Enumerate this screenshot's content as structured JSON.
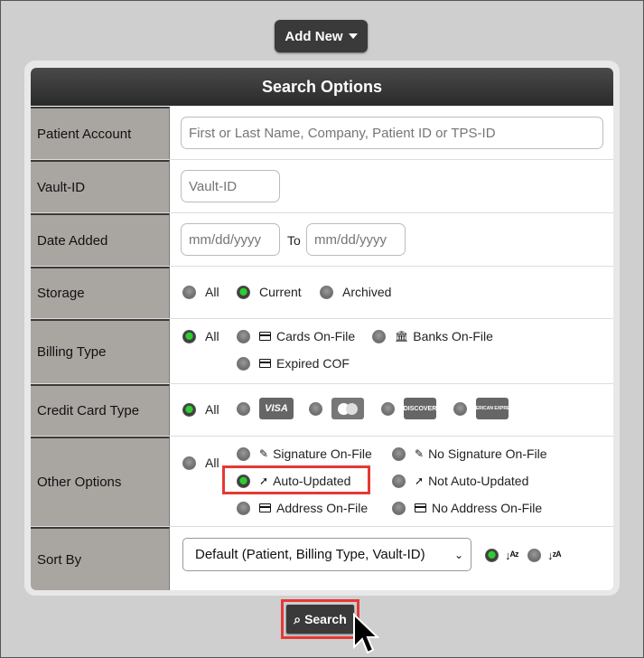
{
  "toolbar": {
    "add_new_label": "Add New"
  },
  "panel": {
    "title": "Search Options"
  },
  "patient_account": {
    "label": "Patient Account",
    "placeholder": "First or Last Name, Company, Patient ID or TPS-ID"
  },
  "vault_id": {
    "label": "Vault-ID",
    "placeholder": "Vault-ID"
  },
  "date_added": {
    "label": "Date Added",
    "from_placeholder": "mm/dd/yyyy",
    "to_label": "To",
    "to_placeholder": "mm/dd/yyyy"
  },
  "storage": {
    "label": "Storage",
    "options": [
      "All",
      "Current",
      "Archived"
    ],
    "selected": "Current"
  },
  "billing_type": {
    "label": "Billing Type",
    "options": [
      "All",
      "Cards On-File",
      "Banks On-File",
      "Expired COF"
    ],
    "selected": "All"
  },
  "credit_card_type": {
    "label": "Credit Card Type",
    "options": [
      "All",
      "VISA",
      "MasterCard",
      "DISCOVER",
      "AMERICAN EXPRESS"
    ],
    "selected": "All"
  },
  "other_options": {
    "label": "Other Options",
    "options": [
      "All",
      "Signature On-File",
      "No Signature On-File",
      "Auto-Updated",
      "Not Auto-Updated",
      "Address On-File",
      "No Address On-File"
    ],
    "selected": "Auto-Updated"
  },
  "sort_by": {
    "label": "Sort By",
    "value": "Default (Patient, Billing Type, Vault-ID)",
    "asc_icon": "sort-alpha-asc-icon",
    "desc_icon": "sort-alpha-desc-icon",
    "direction": "ascending"
  },
  "actions": {
    "search_label": "Search"
  },
  "colors": {
    "accent_green": "#2ecc2e",
    "highlight_red": "#e53935",
    "header_dark": "#3a3a3a"
  }
}
